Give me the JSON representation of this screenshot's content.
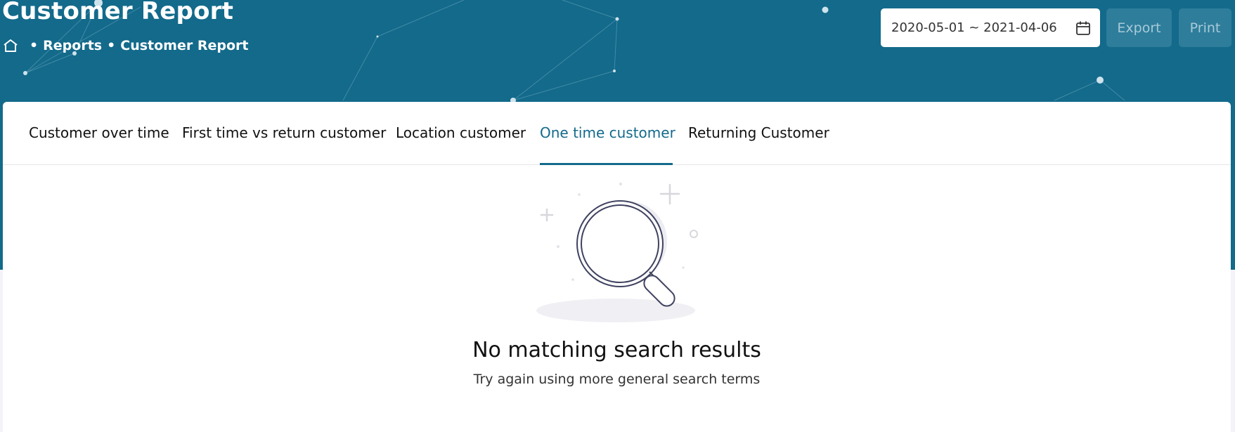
{
  "header": {
    "title": "Customer Report",
    "breadcrumb": [
      {
        "label": "Reports"
      },
      {
        "label": "Customer Report"
      }
    ],
    "breadcrumb_separator": "•",
    "date_range": "2020-05-01 ~ 2021-04-06",
    "export_label": "Export",
    "print_label": "Print"
  },
  "tabs": [
    {
      "label": "Customer over time",
      "active": false
    },
    {
      "label": "First time vs return customer",
      "active": false
    },
    {
      "label": "Location customer",
      "active": false
    },
    {
      "label": "One time customer",
      "active": true
    },
    {
      "label": "Returning Customer",
      "active": false
    }
  ],
  "empty_state": {
    "title": "No matching search results",
    "subtitle": "Try again using more general search terms",
    "icon": "magnifier-illustration"
  },
  "colors": {
    "header_bg": "#136a8b",
    "accent": "#136a8b",
    "page_bg": "#f4f3fa"
  }
}
